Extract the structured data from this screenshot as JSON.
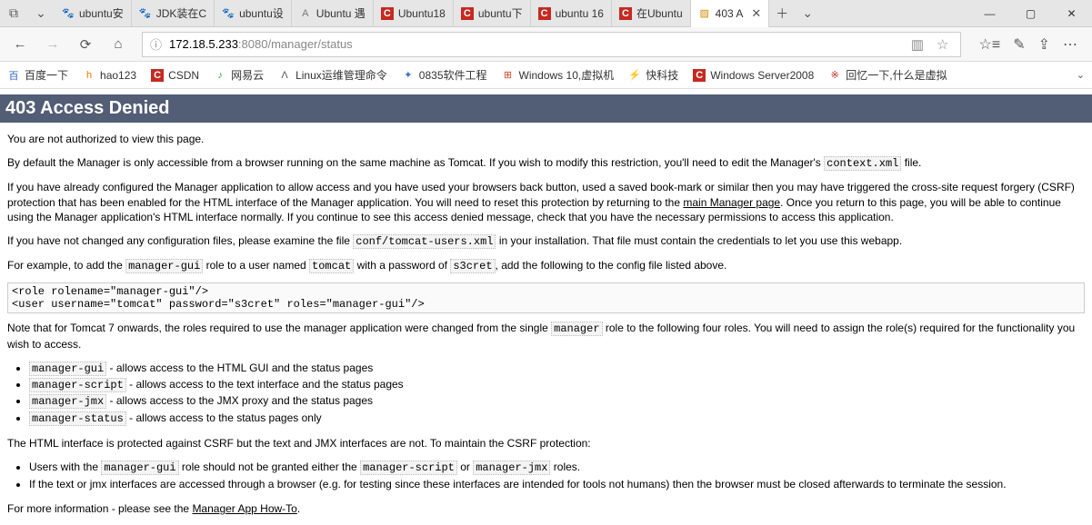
{
  "tabs": [
    {
      "icon": "🐾",
      "iconClass": "fav-blue",
      "label": "ubuntu安",
      "active": false
    },
    {
      "icon": "🐾",
      "iconClass": "fav-blue",
      "label": "JDK装在C",
      "active": false
    },
    {
      "icon": "🐾",
      "iconClass": "fav-blue",
      "label": "ubuntu设",
      "active": false
    },
    {
      "icon": "A",
      "iconClass": "fav-grey",
      "label": "Ubuntu 遇",
      "active": false
    },
    {
      "icon": "C",
      "iconClass": "fav-csdn",
      "label": "Ubuntu18",
      "active": false
    },
    {
      "icon": "C",
      "iconClass": "fav-csdn",
      "label": "ubuntu下",
      "active": false
    },
    {
      "icon": "C",
      "iconClass": "fav-csdn",
      "label": "ubuntu 16",
      "active": false
    },
    {
      "icon": "C",
      "iconClass": "fav-csdn",
      "label": "在Ubuntu",
      "active": false
    },
    {
      "icon": "▨",
      "iconClass": "fav-img",
      "label": "403 A",
      "active": true
    }
  ],
  "nav": {
    "url_grey_prefix": "172.18.5.233",
    "url_rest": ":8080/manager/status"
  },
  "bookmarks": [
    {
      "icon": "百",
      "iconColor": "#2a60c8",
      "label": "百度一下"
    },
    {
      "icon": "h",
      "iconColor": "#e87b00",
      "label": "hao123"
    },
    {
      "icon": "C",
      "iconClass": "fav-csdn",
      "label": "CSDN"
    },
    {
      "icon": "♪",
      "iconColor": "#2a9e44",
      "label": "网易云"
    },
    {
      "icon": "Λ",
      "iconColor": "#555",
      "label": "Linux运维管理命令"
    },
    {
      "icon": "✦",
      "iconColor": "#3a6fbf",
      "label": "0835软件工程"
    },
    {
      "icon": "⊞",
      "iconColor": "#d24726",
      "label": "Windows 10,虚拟机"
    },
    {
      "icon": "⚡",
      "iconColor": "#333",
      "label": "快科技"
    },
    {
      "icon": "C",
      "iconClass": "fav-csdn",
      "label": "Windows Server2008"
    },
    {
      "icon": "※",
      "iconColor": "#c52920",
      "label": "回忆一下,什么是虚拟"
    }
  ],
  "page": {
    "title": "403 Access Denied",
    "p1": "You are not authorized to view this page.",
    "p2_a": "By default the Manager is only accessible from a browser running on the same machine as Tomcat. If you wish to modify this restriction, you'll need to edit the Manager's ",
    "p2_code": "context.xml",
    "p2_b": " file.",
    "p3_a": "If you have already configured the Manager application to allow access and you have used your browsers back button, used a saved book-mark or similar then you may have triggered the cross-site request forgery (CSRF) protection that has been enabled for the HTML interface of the Manager application. You will need to reset this protection by returning to the ",
    "p3_link": "main Manager page",
    "p3_b": ". Once you return to this page, you will be able to continue using the Manager application's HTML interface normally. If you continue to see this access denied message, check that you have the necessary permissions to access this application.",
    "p4_a": "If you have not changed any configuration files, please examine the file ",
    "p4_code": "conf/tomcat-users.xml",
    "p4_b": " in your installation. That file must contain the credentials to let you use this webapp.",
    "p5_a": "For example, to add the ",
    "p5_c1": "manager-gui",
    "p5_b": " role to a user named ",
    "p5_c2": "tomcat",
    "p5_c": " with a password of ",
    "p5_c3": "s3cret",
    "p5_d": ", add the following to the config file listed above.",
    "pre": "<role rolename=\"manager-gui\"/>\n<user username=\"tomcat\" password=\"s3cret\" roles=\"manager-gui\"/>",
    "p6_a": "Note that for Tomcat 7 onwards, the roles required to use the manager application were changed from the single ",
    "p6_code": "manager",
    "p6_b": " role to the following four roles. You will need to assign the role(s) required for the functionality you wish to access.",
    "roles": [
      {
        "code": "manager-gui",
        "desc": " - allows access to the HTML GUI and the status pages"
      },
      {
        "code": "manager-script",
        "desc": " - allows access to the text interface and the status pages"
      },
      {
        "code": "manager-jmx",
        "desc": " - allows access to the JMX proxy and the status pages"
      },
      {
        "code": "manager-status",
        "desc": " - allows access to the status pages only"
      }
    ],
    "p7": "The HTML interface is protected against CSRF but the text and JMX interfaces are not. To maintain the CSRF protection:",
    "csrf": [
      {
        "pre": "Users with the ",
        "c1": "manager-gui",
        "mid": " role should not be granted either the ",
        "c2": "manager-script",
        "mid2": " or ",
        "c3": "manager-jmx",
        "post": " roles."
      },
      {
        "text": "If the text or jmx interfaces are accessed through a browser (e.g. for testing since these interfaces are intended for tools not humans) then the browser must be closed afterwards to terminate the session."
      }
    ],
    "p8_a": "For more information - please see the ",
    "p8_link": "Manager App How-To",
    "p8_b": "."
  }
}
